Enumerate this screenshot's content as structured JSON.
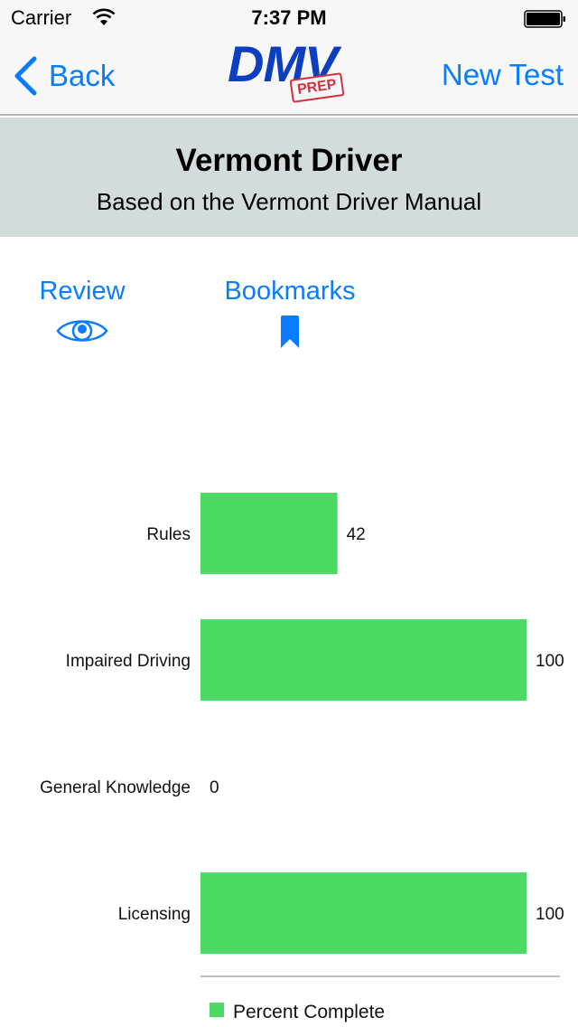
{
  "status_bar": {
    "carrier": "Carrier",
    "time": "7:37 PM",
    "wifi_icon": "wifi-icon",
    "battery_icon": "battery-full-icon"
  },
  "nav": {
    "back_label": "Back",
    "back_icon": "chevron-left-icon",
    "logo_main": "DMV",
    "logo_stamp": "PREP",
    "new_test_label": "New Test",
    "accent_color": "#0a7cff"
  },
  "header": {
    "title": "Vermont Driver",
    "subtitle": "Based on the Vermont Driver Manual"
  },
  "actions": {
    "review": {
      "label": "Review",
      "icon": "eye-icon"
    },
    "bookmarks": {
      "label": "Bookmarks",
      "icon": "bookmark-icon"
    }
  },
  "chart_data": {
    "type": "bar",
    "orientation": "horizontal",
    "title": "",
    "xlabel": "",
    "ylabel": "",
    "categories": [
      "Rules",
      "Impaired Driving",
      "General Knowledge",
      "Licensing"
    ],
    "series": [
      {
        "name": "Percent Complete",
        "values": [
          42,
          100,
          0,
          100
        ],
        "color": "#4cd964"
      }
    ],
    "xlim": [
      0,
      100
    ],
    "grid": false,
    "data_labels": true,
    "legend": {
      "position": "bottom-left",
      "entries": [
        "Percent Complete"
      ]
    }
  }
}
